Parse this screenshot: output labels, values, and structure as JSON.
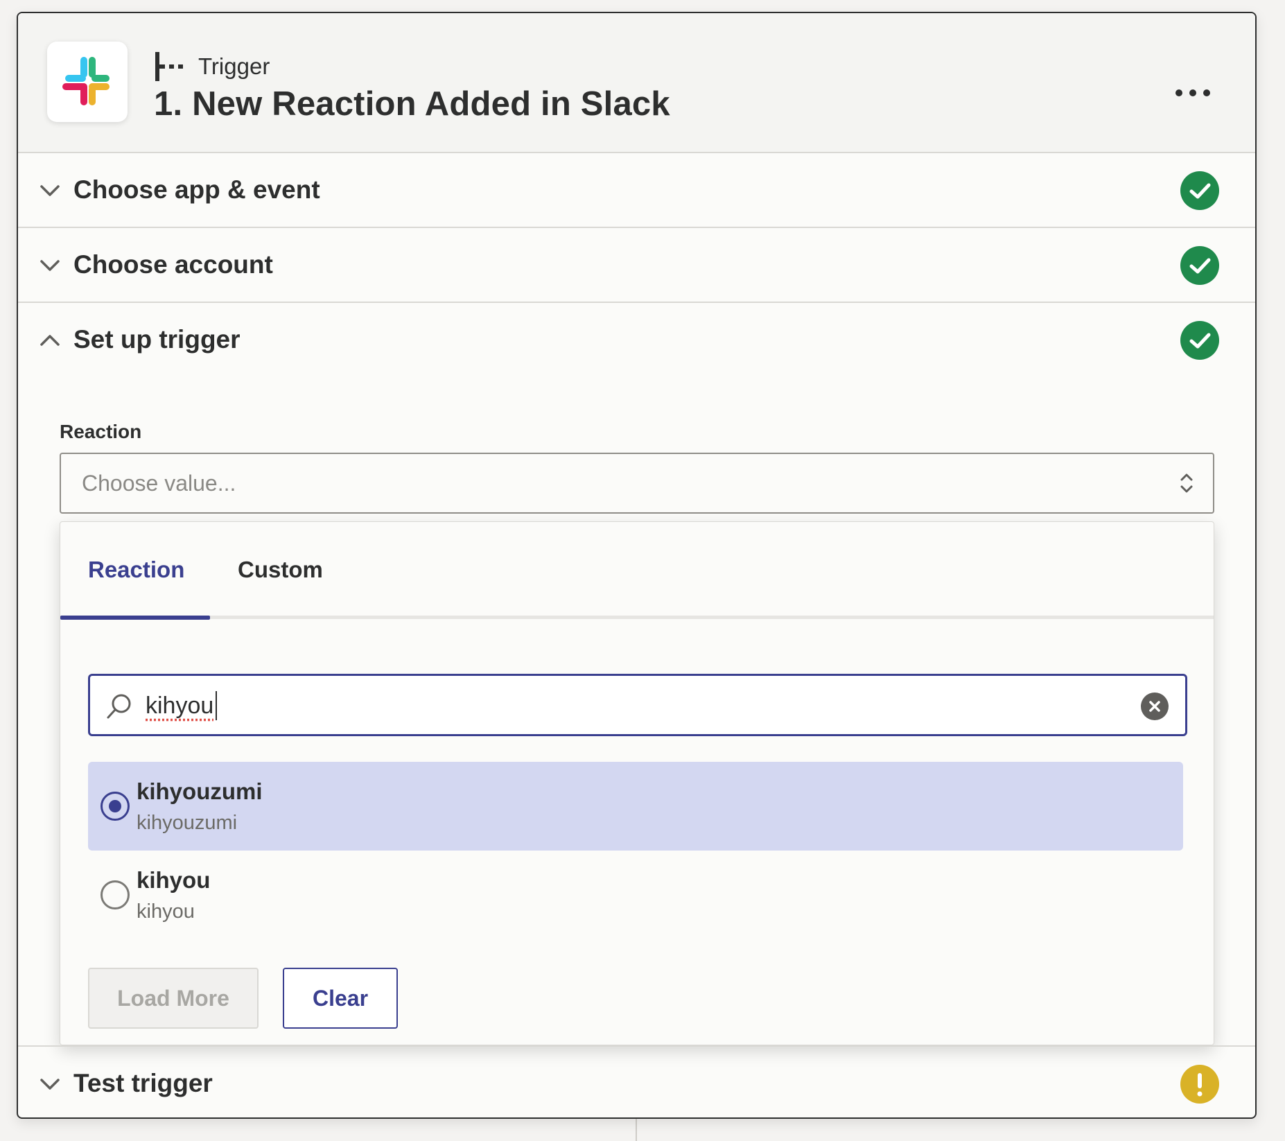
{
  "header": {
    "app_icon": "slack-logo-icon",
    "step_kind": "Trigger",
    "step_kind_icon": "trigger-icon",
    "title": "1. New Reaction Added in Slack",
    "more_icon": "more-horizontal-icon"
  },
  "sections": [
    {
      "label": "Choose app & event",
      "expanded": false,
      "status": "complete"
    },
    {
      "label": "Choose account",
      "expanded": false,
      "status": "complete"
    },
    {
      "label": "Set up trigger",
      "expanded": true,
      "status": "complete"
    },
    {
      "label": "Test trigger",
      "expanded": false,
      "status": "warning"
    }
  ],
  "field": {
    "label": "Reaction",
    "placeholder": "Choose value..."
  },
  "dropdown": {
    "tabs": [
      {
        "label": "Reaction",
        "active": true
      },
      {
        "label": "Custom",
        "active": false
      }
    ],
    "search": {
      "value": "kihyou"
    },
    "options": [
      {
        "title": "kihyouzumi",
        "subtitle": "kihyouzumi",
        "selected": true
      },
      {
        "title": "kihyou",
        "subtitle": "kihyou",
        "selected": false
      }
    ],
    "load_more_label": "Load More",
    "clear_label": "Clear"
  },
  "colors": {
    "accent": "#3a3f8f",
    "selected_bg": "#d3d7f1",
    "success": "#1f8a4c",
    "warning": "#d9b227",
    "slack_blue": "#36c5f0",
    "slack_green": "#2eb67d",
    "slack_yellow": "#ecb22e",
    "slack_red": "#e01e5a"
  }
}
